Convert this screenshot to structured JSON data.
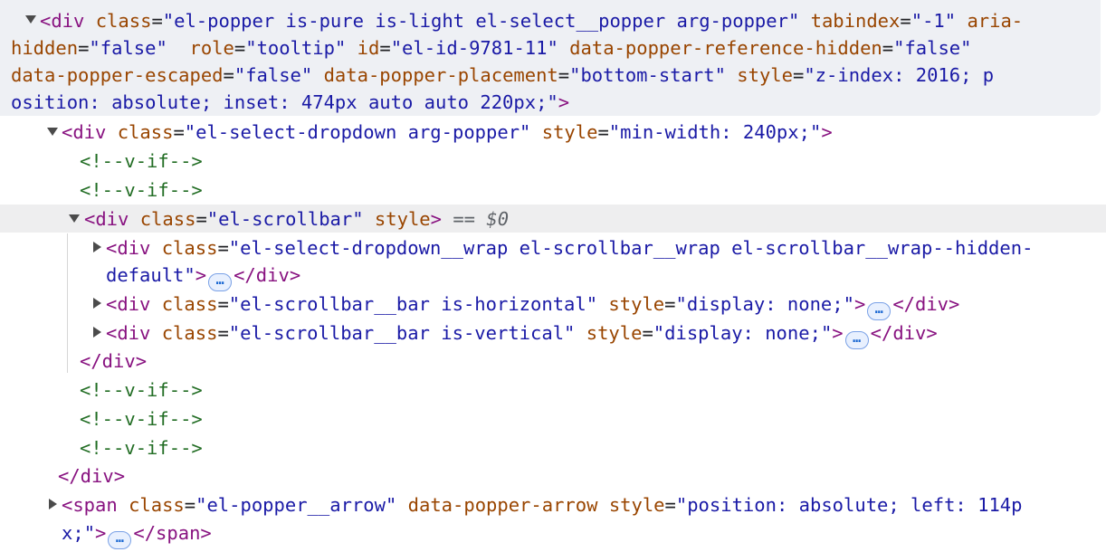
{
  "nodes": {
    "popper": {
      "tag": "div",
      "class_attr": "class",
      "class_val": "el-popper is-pure is-light el-select__popper arg-popper",
      "tabindex_attr": "tabindex",
      "tabindex_val": "-1",
      "aria_attr_1": "aria-",
      "aria_attr_2": "hidden",
      "aria_val": "false",
      "role_attr": "role",
      "role_val": "tooltip",
      "id_attr": "id",
      "id_val": "el-id-9781-11",
      "ref_hidden_attr": "data-popper-reference-hidden",
      "ref_hidden_val": "false",
      "escaped_attr": "data-popper-escaped",
      "escaped_val": "false",
      "placement_attr": "data-popper-placement",
      "placement_val": "bottom-start",
      "style_attr": "style",
      "style_val_1": "z-index: 2016; p",
      "style_val_2": "osition: absolute; inset: 474px auto auto 220px;"
    },
    "dropdown": {
      "tag": "div",
      "class_attr": "class",
      "class_val": "el-select-dropdown arg-popper",
      "style_attr": "style",
      "style_val": "min-width: 240px;"
    },
    "scrollbar": {
      "tag": "div",
      "class_attr": "class",
      "class_val": "el-scrollbar",
      "style_attr": "style",
      "selected_marker": "== $0"
    },
    "wrap": {
      "tag": "div",
      "class_attr": "class",
      "class_val_1": "el-select-dropdown__wrap el-scrollbar__wrap el-scrollbar__wrap--hidden-",
      "class_val_2": "default"
    },
    "bar_h": {
      "tag": "div",
      "class_attr": "class",
      "class_val": "el-scrollbar__bar is-horizontal",
      "style_attr": "style",
      "style_val": "display: none;"
    },
    "bar_v": {
      "tag": "div",
      "class_attr": "class",
      "class_val": "el-scrollbar__bar is-vertical",
      "style_attr": "style",
      "style_val": "display: none;"
    },
    "arrow": {
      "tag": "span",
      "class_attr": "class",
      "class_val": "el-popper__arrow",
      "arrow_attr": "data-popper-arrow",
      "style_attr": "style",
      "style_val_1": "position: absolute; left: 114p",
      "style_val_2": "x;"
    }
  },
  "comments": {
    "v_if": "<!--v-if-->"
  },
  "closing": {
    "div": "</div>",
    "span": "</span>"
  },
  "ellipsis": "…",
  "icons": {
    "expanded": "triangle-down-icon",
    "collapsed": "triangle-right-icon"
  },
  "colors": {
    "tag": "#881280",
    "attribute": "#994500",
    "value": "#1a1aa6",
    "comment": "#236e25",
    "highlight": "#eef0f4",
    "selected_row": "#eeeeef"
  }
}
